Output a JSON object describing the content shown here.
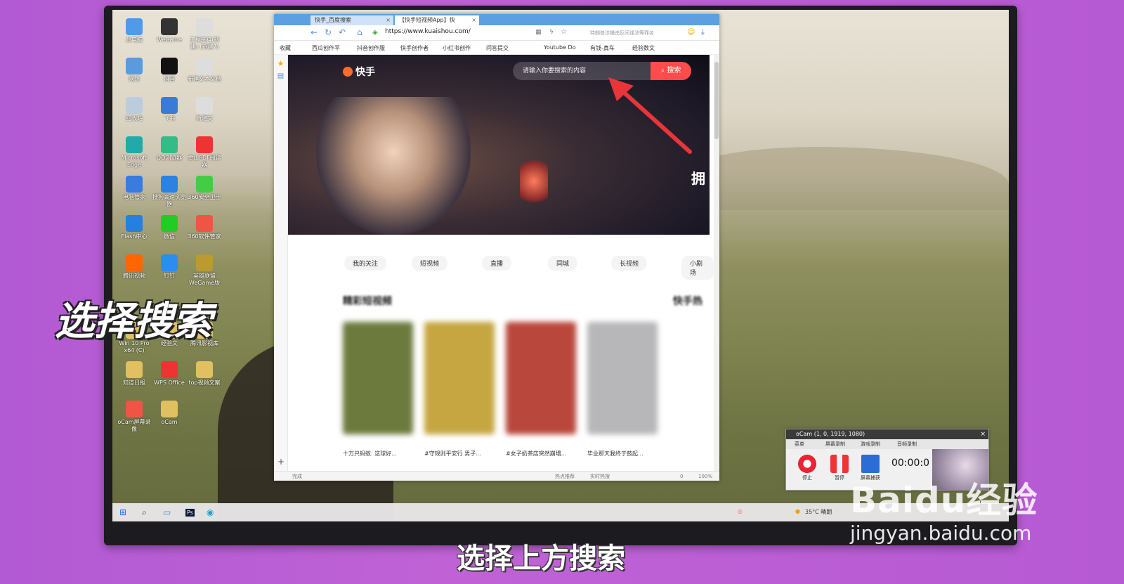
{
  "overlay": {
    "caption_left": "选择搜索",
    "subtitle": "选择上方搜索",
    "watermark_logo": "Baidu经验",
    "watermark_url": "jingyan.baidu.com"
  },
  "desktop": {
    "icons": [
      {
        "label": "此电脑",
        "color": "#4f9be8"
      },
      {
        "label": "WeGame",
        "color": "#333"
      },
      {
        "label": "工程资料(新建) (新建7)",
        "color": "#ddd"
      },
      {
        "label": "网络",
        "color": "#5a9be0"
      },
      {
        "label": "抖音",
        "color": "#111"
      },
      {
        "label": "新建文本文档",
        "color": "#ddd"
      },
      {
        "label": "回收站",
        "color": "#bcd"
      },
      {
        "label": "飞书",
        "color": "#3a7bd5"
      },
      {
        "label": "新建文",
        "color": "#ddd"
      },
      {
        "label": "Microsoft Edge",
        "color": "#2aa"
      },
      {
        "label": "QQ浏览器",
        "color": "#3b8"
      },
      {
        "label": "金山PDF阅读器",
        "color": "#e33"
      },
      {
        "label": "电脑管家",
        "color": "#3a7be0"
      },
      {
        "label": "搜狗高速浏览器",
        "color": "#2b82e0"
      },
      {
        "label": "360安全卫士",
        "color": "#4c4"
      },
      {
        "label": "Flash中心",
        "color": "#2580e0"
      },
      {
        "label": "微信",
        "color": "#2c2"
      },
      {
        "label": "360软件管家",
        "color": "#e54"
      },
      {
        "label": "腾讯视频",
        "color": "#f60"
      },
      {
        "label": "钉钉",
        "color": "#2a8ef0"
      },
      {
        "label": "英雄联盟WeGame版",
        "color": "#b93"
      },
      {
        "label": "Win 10 Pro x64 (C)",
        "color": "#e0c060"
      },
      {
        "label": "经验文",
        "color": "#e0c060"
      },
      {
        "label": "腾讯影视库",
        "color": "#e0c060"
      },
      {
        "label": "知道日报",
        "color": "#e0c060"
      },
      {
        "label": "WPS Office",
        "color": "#e33"
      },
      {
        "label": "top视频文案",
        "color": "#e0c060"
      },
      {
        "label": "oCam屏幕录像",
        "color": "#e54"
      },
      {
        "label": "oCam",
        "color": "#e0c060"
      }
    ]
  },
  "browser": {
    "tabs": [
      {
        "label": "快手_百度搜索"
      },
      {
        "label": "【快手短视频App】快"
      }
    ],
    "url": "https://www.kuaishou.com/",
    "search_hint": "特朗普涉嫌违反间谍法等罪名",
    "bookmarks": [
      "收藏",
      "西瓜创作平",
      "抖音创作服",
      "快手创作者",
      "小红书创作",
      "问答提交",
      "Youtube Do",
      "有钱-真车",
      "经验数文"
    ],
    "status": "完成",
    "status_right": [
      "热点推荐",
      "实时热搜",
      "0",
      "100%"
    ],
    "site": {
      "logo": "快手",
      "search_placeholder": "请输入你要搜索的内容",
      "search_button": "搜索",
      "banner_text": "拥",
      "categories": [
        "我的关注",
        "短视频",
        "直播",
        "同城",
        "长视频",
        "小剧场"
      ],
      "section_title": "精彩短视频",
      "section_title_right": "快手热",
      "videos": [
        {
          "caption": "十万只蚂蚁: 这球好...",
          "color": "#6d7a3e"
        },
        {
          "caption": "#守规则平安行 男子...",
          "color": "#c6a640"
        },
        {
          "caption": "#女子奶茶店突然崩塌...",
          "color": "#b9473c"
        },
        {
          "caption": "毕业那天我终于鼓起...",
          "color": "#b7b6b8"
        }
      ]
    }
  },
  "taskbar": {
    "weather": "35°C 晴朗",
    "icons": [
      "windows-start",
      "search",
      "file-explorer",
      "photoshop",
      "edge"
    ]
  },
  "ocam": {
    "title": "oCam (1, 0, 1919, 1080)",
    "tabs": [
      "菜单",
      "屏幕录制",
      "游戏录制",
      "音频录制"
    ],
    "buttons": [
      "停止",
      "暂停",
      "屏幕捕获"
    ],
    "time": "00:00:0"
  }
}
